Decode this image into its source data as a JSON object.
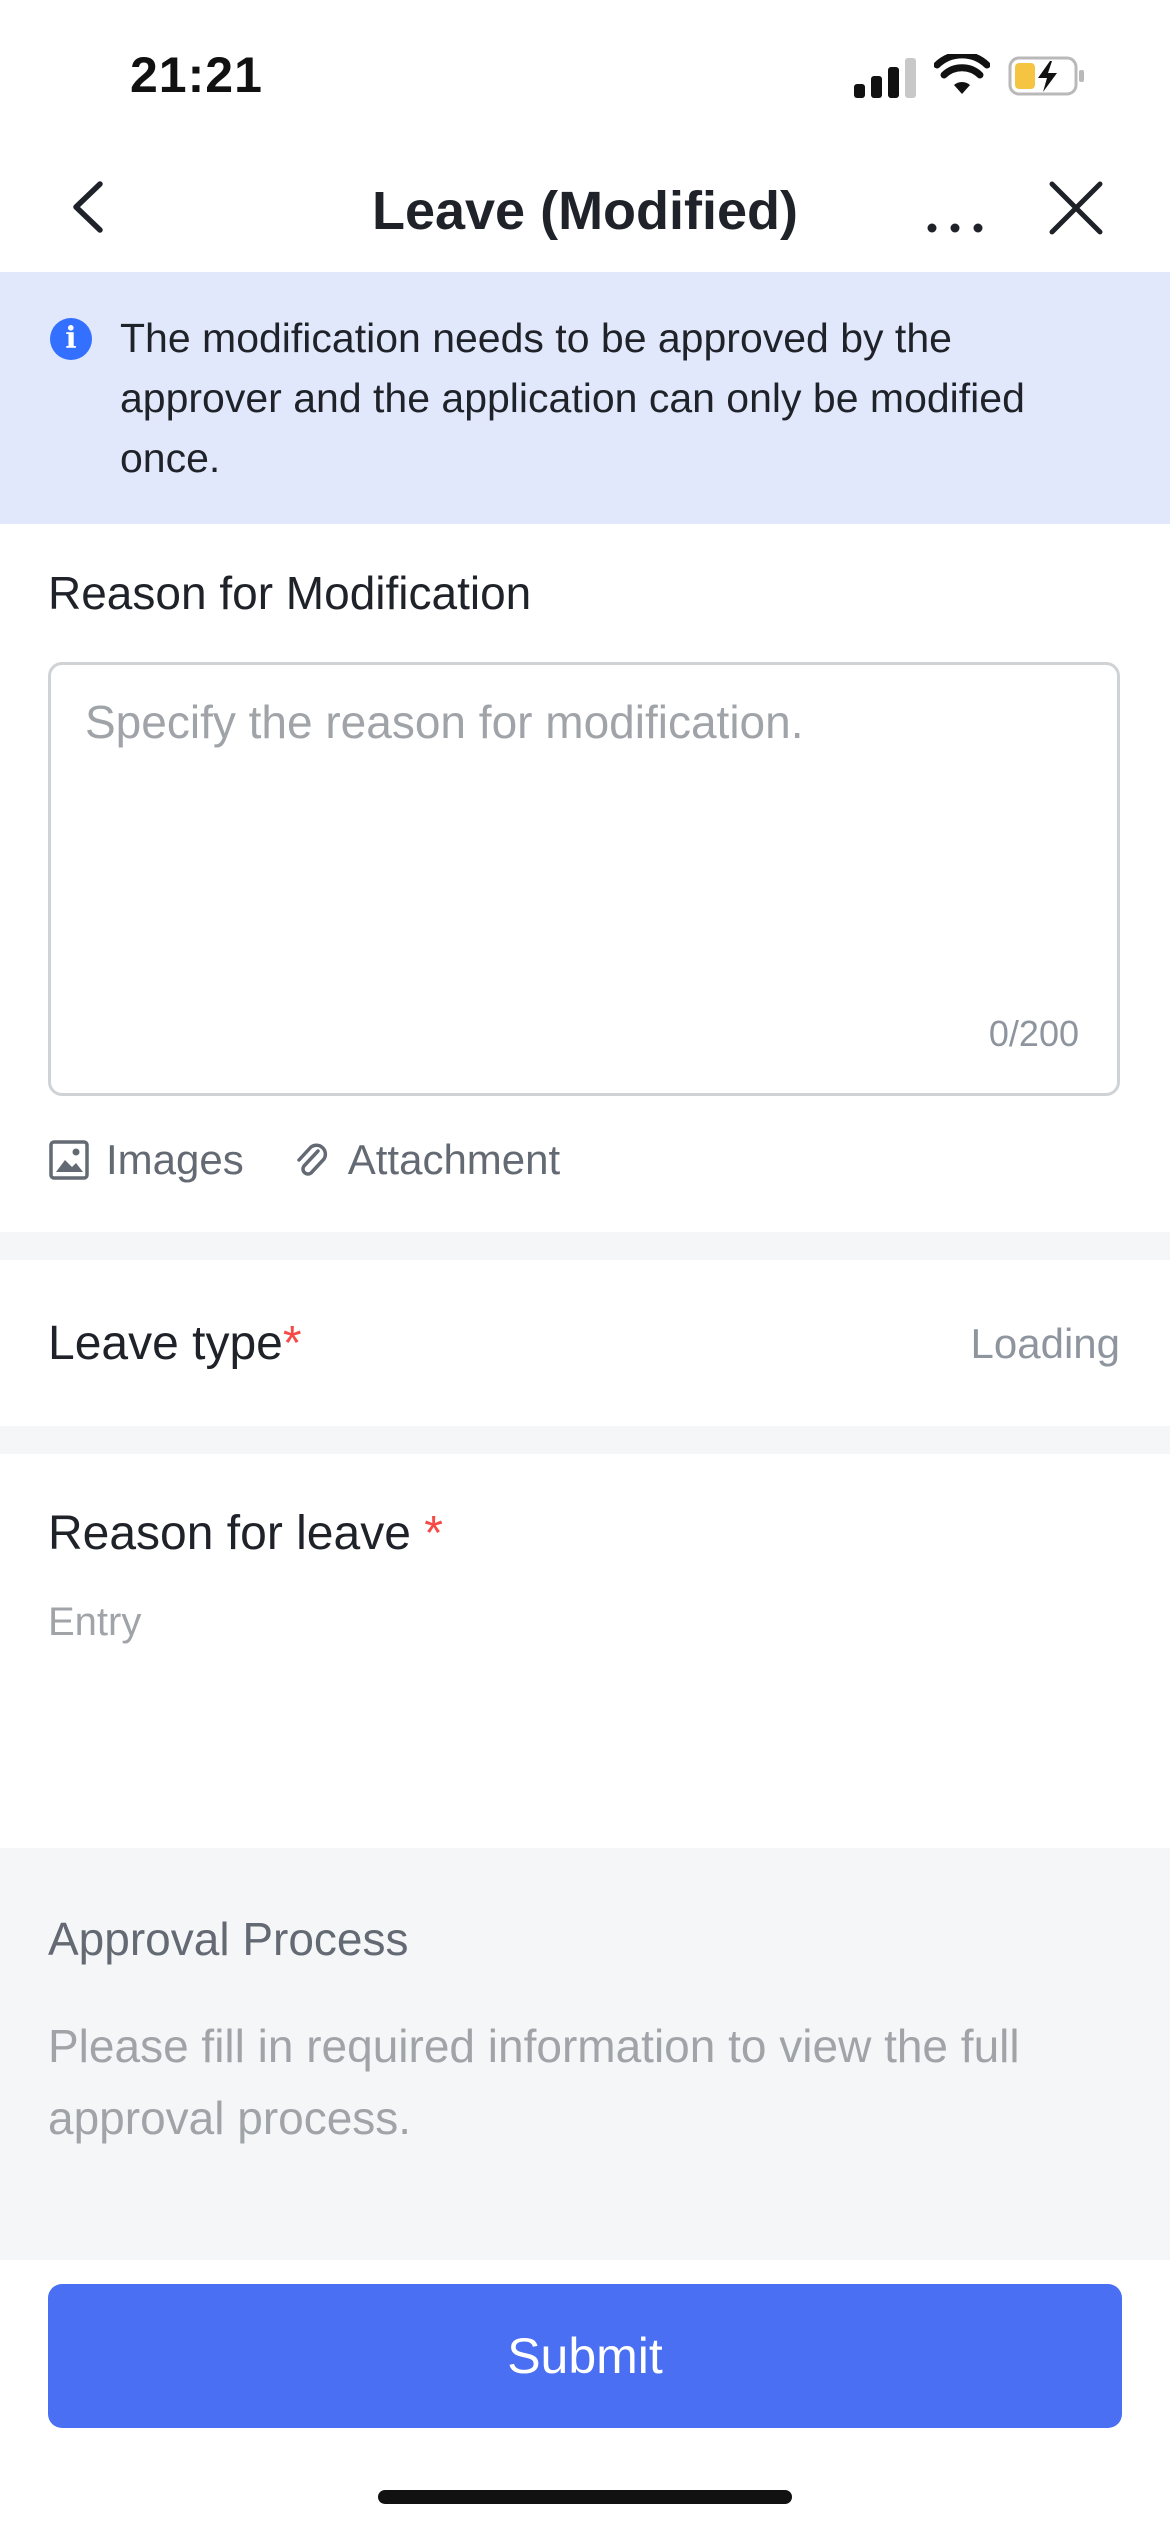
{
  "status_bar": {
    "time": "21:21"
  },
  "nav": {
    "title": "Leave (Modified)"
  },
  "notice": {
    "text": "The modification needs to be approved by the approver and the application can only be modified once."
  },
  "modification": {
    "label": "Reason for Modification",
    "placeholder": "Specify the reason for modification.",
    "counter": "0/200",
    "images_label": "Images",
    "attachment_label": "Attachment"
  },
  "leave_type": {
    "label": "Leave type",
    "required_mark": "*",
    "value": "Loading"
  },
  "reason_for_leave": {
    "label": "Reason for leave ",
    "required_mark": "*",
    "placeholder": "Entry"
  },
  "approval": {
    "title": "Approval Process",
    "text": "Please fill in required information to view the full approval process."
  },
  "footer": {
    "submit_label": "Submit"
  },
  "colors": {
    "accent": "#4a6ff2",
    "notice_bg": "#e1e8fb",
    "required": "#f54a45"
  }
}
